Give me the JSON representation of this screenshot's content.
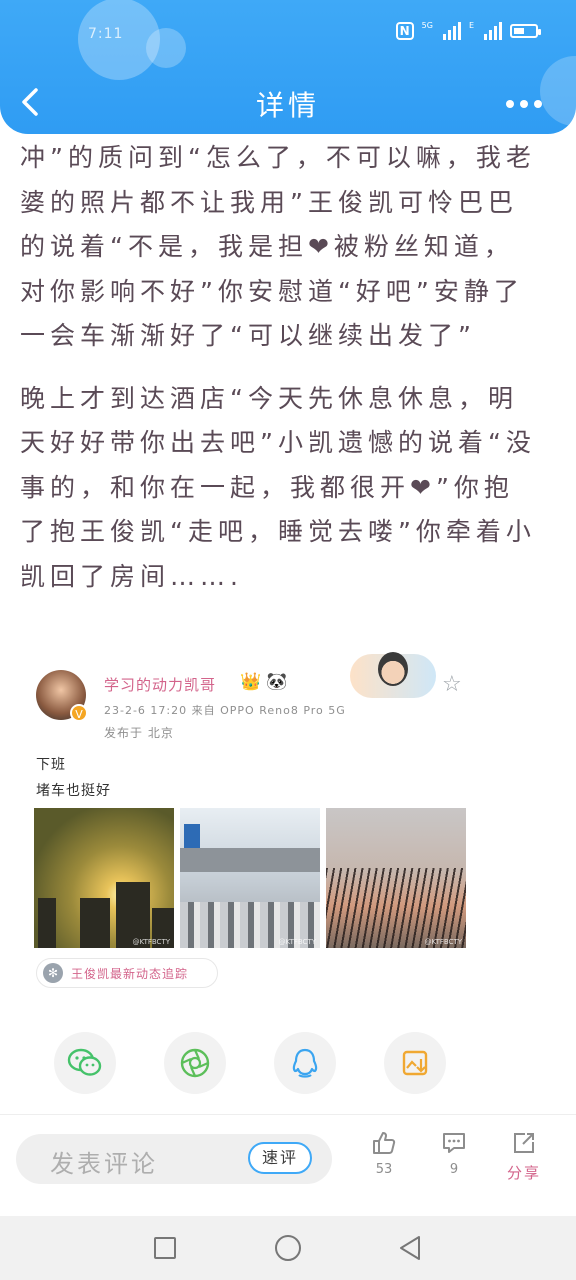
{
  "status_bar": {
    "time": "7:11",
    "network_1": "5G",
    "network_2": "E"
  },
  "header": {
    "title": "详情"
  },
  "article": {
    "paragraphs": [
      "冲”的质问到“怎么了，不可以嘛，我老婆的照片都不让我用”王俊凯可怜巴巴的说着“不是，我是担❤被粉丝知道，对你影响不好”你安慰道“好吧”安静了一会车渐渐好了“可以继续出发了”",
      "晚上才到达酒店“今天先休息休息，明天好好带你出去吧”小凯遗憾的说着“没事的，和你在一起，我都很开❤”你抱了抱王俊凯“走吧，睡觉去喽”你牵着小凯回了房间……."
    ]
  },
  "post": {
    "username": "学习的动力凯哥",
    "badges": [
      "crown-icon",
      "panda-icon"
    ],
    "meta": "23-2-6 17:20  来自 OPPO Reno8 Pro 5G",
    "location": "发布于 北京",
    "text_lines": [
      "下班",
      "堵车也挺好"
    ],
    "photo_watermarks": [
      "@KTFBCTY",
      "@KTFBCTY",
      "@KTFBCTY"
    ],
    "topic": "王俊凯最新动态追踪"
  },
  "share_icons": [
    "wechat-icon",
    "moments-icon",
    "qq-icon",
    "save-image-icon"
  ],
  "comment_bar": {
    "placeholder": "发表评论",
    "quick_comment": "速评",
    "like_count": "53",
    "comment_count": "9",
    "share_label": "分享"
  },
  "colors": {
    "header_blue": "#3fa9f7",
    "accent_pink": "#d3648b",
    "text": "#5a4a56"
  }
}
